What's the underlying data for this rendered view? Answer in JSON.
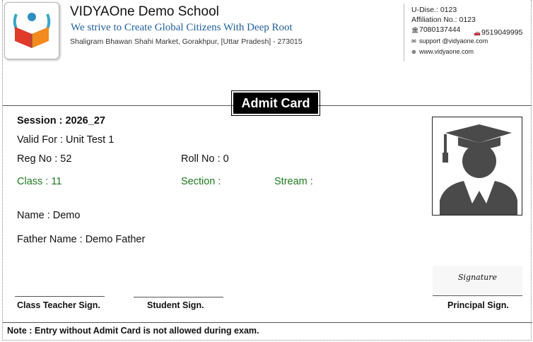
{
  "school": {
    "name": "VIDYAOne Demo School",
    "tagline": "We strive to Create Global Citizens With Deep Root",
    "address": "Shaligram Bhawan Shahi Market, Gorakhpur, [Uttar Pradesh] - 273015"
  },
  "contact": {
    "udise": "U-Dise.: 0123",
    "affiliation": "Affiliation No.: 0123",
    "phone1": "7080137444",
    "phone2": "9519049995",
    "email": "support @vidyaone.com",
    "website": "www.vidyaone.com"
  },
  "card": {
    "title": "Admit Card",
    "session": "Session : 2026_27",
    "valid_for": "Valid For : Unit Test 1",
    "reg_no": "Reg No : 52",
    "roll_no": "Roll No : 0",
    "class": "Class : 11",
    "section": "Section :",
    "stream": "Stream :",
    "name": "Name : Demo",
    "father_name": "Father Name : Demo Father"
  },
  "signature_image_text": "Signature",
  "signatures": {
    "class_teacher": "Class Teacher Sign.",
    "student": "Student Sign.",
    "principal": "Principal Sign."
  },
  "note": "Note : Entry without Admit Card is not allowed during exam.",
  "colors": {
    "green": "#1e7a1e",
    "tagline_blue": "#1f5f9a"
  }
}
